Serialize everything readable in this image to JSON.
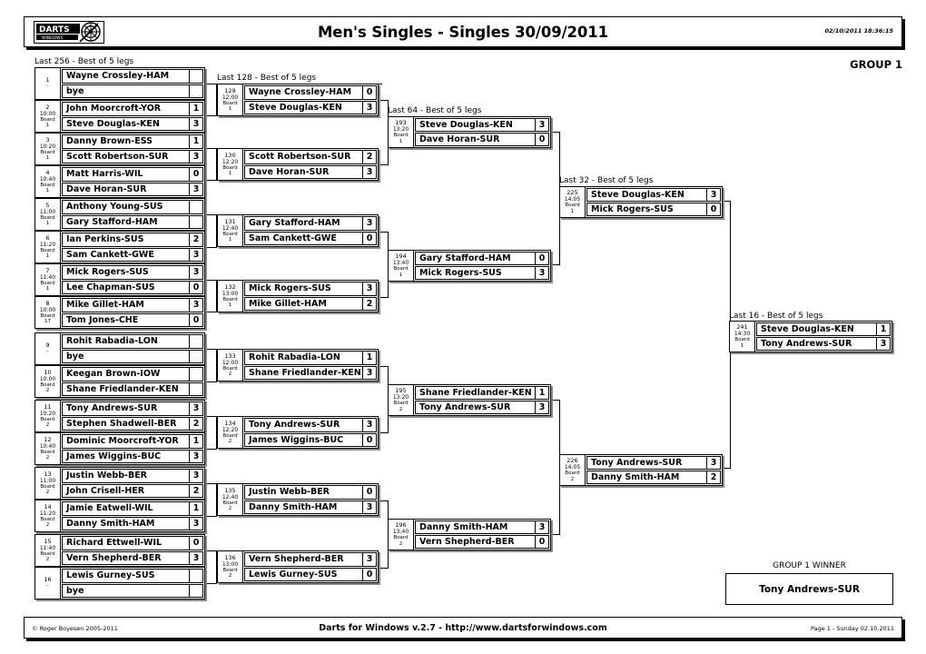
{
  "header": {
    "title": "Men's Singles - Singles 30/09/2011",
    "timestamp": "02/10/2011 18:36:15",
    "logo_text": "DARTS",
    "logo_sub": "WINDOWS"
  },
  "group_label": "GROUP 1",
  "rounds": [
    {
      "id": "r256",
      "title": "Last 256 - Best of 5 legs"
    },
    {
      "id": "r128",
      "title": "Last 128 - Best of 5 legs"
    },
    {
      "id": "r64",
      "title": "Last 64 - Best of 5 legs"
    },
    {
      "id": "r32",
      "title": "Last 32 - Best of 5 legs"
    },
    {
      "id": "r16",
      "title": "Last 16 - Best of 5 legs"
    }
  ],
  "matches": {
    "m1": {
      "no": "1",
      "time": "",
      "board_label": "",
      "board_no": "-",
      "p1": "Wayne Crossley-HAM",
      "s1": "",
      "p2": "bye",
      "s2": ""
    },
    "m2": {
      "no": "2",
      "time": "10:00",
      "board_label": "Board",
      "board_no": "1",
      "p1": "John Moorcroft-YOR",
      "s1": "1",
      "p2": "Steve Douglas-KEN",
      "s2": "3"
    },
    "m3": {
      "no": "3",
      "time": "10:20",
      "board_label": "Board",
      "board_no": "1",
      "p1": "Danny Brown-ESS",
      "s1": "1",
      "p2": "Scott Robertson-SUR",
      "s2": "3"
    },
    "m4": {
      "no": "4",
      "time": "10:40",
      "board_label": "Board",
      "board_no": "1",
      "p1": "Matt Harris-WIL",
      "s1": "0",
      "p2": "Dave Horan-SUR",
      "s2": "3"
    },
    "m5": {
      "no": "5",
      "time": "11:00",
      "board_label": "Board",
      "board_no": "1",
      "p1": "Anthony Young-SUS",
      "s1": "",
      "p2": "Gary Stafford-HAM",
      "s2": ""
    },
    "m6": {
      "no": "6",
      "time": "11:20",
      "board_label": "Board",
      "board_no": "1",
      "p1": "Ian  Perkins-SUS",
      "s1": "2",
      "p2": "Sam Cankett-GWE",
      "s2": "3"
    },
    "m7": {
      "no": "7",
      "time": "11:40",
      "board_label": "Board",
      "board_no": "1",
      "p1": "Mick Rogers-SUS",
      "s1": "3",
      "p2": "Lee Chapman-SUS",
      "s2": "0"
    },
    "m8": {
      "no": "8",
      "time": "10:00",
      "board_label": "Board",
      "board_no": "17",
      "p1": "Mike Gillet-HAM",
      "s1": "3",
      "p2": "Tom Jones-CHE",
      "s2": "0"
    },
    "m9": {
      "no": "9",
      "time": "",
      "board_label": "",
      "board_no": "-",
      "p1": "Rohit Rabadia-LON",
      "s1": "",
      "p2": "bye",
      "s2": ""
    },
    "m10": {
      "no": "10",
      "time": "10:00",
      "board_label": "Board",
      "board_no": "2",
      "p1": "Keegan Brown-IOW",
      "s1": "",
      "p2": "Shane Friedlander-KEN",
      "s2": ""
    },
    "m11": {
      "no": "11",
      "time": "10:20",
      "board_label": "Board",
      "board_no": "2",
      "p1": "Tony Andrews-SUR",
      "s1": "3",
      "p2": "Stephen Shadwell-BER",
      "s2": "2"
    },
    "m12": {
      "no": "12",
      "time": "10:40",
      "board_label": "Board",
      "board_no": "2",
      "p1": "Dominic Moorcroft-YOR",
      "s1": "1",
      "p2": "James Wiggins-BUC",
      "s2": "3"
    },
    "m13": {
      "no": "13",
      "time": "11:00",
      "board_label": "Board",
      "board_no": "2",
      "p1": "Justin Webb-BER",
      "s1": "3",
      "p2": "John Crisell-HER",
      "s2": "2"
    },
    "m14": {
      "no": "14",
      "time": "11:20",
      "board_label": "Board",
      "board_no": "2",
      "p1": "Jamie Eatwell-WIL",
      "s1": "1",
      "p2": "Danny Smith-HAM",
      "s2": "3"
    },
    "m15": {
      "no": "15",
      "time": "11:40",
      "board_label": "Board",
      "board_no": "2",
      "p1": "Richard Ettwell-WIL",
      "s1": "0",
      "p2": "Vern Shepherd-BER",
      "s2": "3"
    },
    "m16": {
      "no": "16",
      "time": "",
      "board_label": "",
      "board_no": "-",
      "p1": "Lewis Gurney-SUS",
      "s1": "",
      "p2": "bye",
      "s2": ""
    },
    "m129": {
      "no": "129",
      "time": "12:00",
      "board_label": "Board",
      "board_no": "1",
      "p1": "Wayne Crossley-HAM",
      "s1": "0",
      "p2": "Steve Douglas-KEN",
      "s2": "3"
    },
    "m130": {
      "no": "130",
      "time": "12:20",
      "board_label": "Board",
      "board_no": "1",
      "p1": "Scott Robertson-SUR",
      "s1": "2",
      "p2": "Dave Horan-SUR",
      "s2": "3"
    },
    "m131": {
      "no": "131",
      "time": "12:40",
      "board_label": "Board",
      "board_no": "1",
      "p1": "Gary Stafford-HAM",
      "s1": "3",
      "p2": "Sam Cankett-GWE",
      "s2": "0"
    },
    "m132": {
      "no": "132",
      "time": "13:00",
      "board_label": "Board",
      "board_no": "1",
      "p1": "Mick Rogers-SUS",
      "s1": "3",
      "p2": "Mike Gillet-HAM",
      "s2": "2"
    },
    "m133": {
      "no": "133",
      "time": "12:00",
      "board_label": "Board",
      "board_no": "2",
      "p1": "Rohit Rabadia-LON",
      "s1": "1",
      "p2": "Shane Friedlander-KEN",
      "s2": "3"
    },
    "m134": {
      "no": "134",
      "time": "12:20",
      "board_label": "Board",
      "board_no": "2",
      "p1": "Tony Andrews-SUR",
      "s1": "3",
      "p2": "James Wiggins-BUC",
      "s2": "0"
    },
    "m135": {
      "no": "135",
      "time": "12:40",
      "board_label": "Board",
      "board_no": "2",
      "p1": "Justin Webb-BER",
      "s1": "0",
      "p2": "Danny Smith-HAM",
      "s2": "3"
    },
    "m136": {
      "no": "136",
      "time": "13:00",
      "board_label": "Board",
      "board_no": "2",
      "p1": "Vern Shepherd-BER",
      "s1": "3",
      "p2": "Lewis Gurney-SUS",
      "s2": "0"
    },
    "m193": {
      "no": "193",
      "time": "13:20",
      "board_label": "Board",
      "board_no": "1",
      "p1": "Steve Douglas-KEN",
      "s1": "3",
      "p2": "Dave Horan-SUR",
      "s2": "0"
    },
    "m194": {
      "no": "194",
      "time": "13:40",
      "board_label": "Board",
      "board_no": "1",
      "p1": "Gary Stafford-HAM",
      "s1": "0",
      "p2": "Mick Rogers-SUS",
      "s2": "3"
    },
    "m195": {
      "no": "195",
      "time": "13:20",
      "board_label": "Board",
      "board_no": "2",
      "p1": "Shane Friedlander-KEN",
      "s1": "1",
      "p2": "Tony Andrews-SUR",
      "s2": "3"
    },
    "m196": {
      "no": "196",
      "time": "13:40",
      "board_label": "Board",
      "board_no": "2",
      "p1": "Danny Smith-HAM",
      "s1": "3",
      "p2": "Vern Shepherd-BER",
      "s2": "0"
    },
    "m225": {
      "no": "225",
      "time": "14:05",
      "board_label": "Board",
      "board_no": "1",
      "p1": "Steve Douglas-KEN",
      "s1": "3",
      "p2": "Mick Rogers-SUS",
      "s2": "0"
    },
    "m226": {
      "no": "226",
      "time": "14:05",
      "board_label": "Board",
      "board_no": "2",
      "p1": "Tony Andrews-SUR",
      "s1": "3",
      "p2": "Danny Smith-HAM",
      "s2": "2"
    },
    "m241": {
      "no": "241",
      "time": "14:30",
      "board_label": "Board",
      "board_no": "1",
      "p1": "Steve Douglas-KEN",
      "s1": "1",
      "p2": "Tony Andrews-SUR",
      "s2": "3"
    }
  },
  "winner": {
    "caption": "GROUP 1 WINNER",
    "name": "Tony Andrews-SUR"
  },
  "footer": {
    "left": "© Roger Boyesen 2005-2011",
    "center": "Darts for Windows v.2.7 - http://www.dartsforwindows.com",
    "right": "Page 1 - Sunday 02.10.2011"
  }
}
